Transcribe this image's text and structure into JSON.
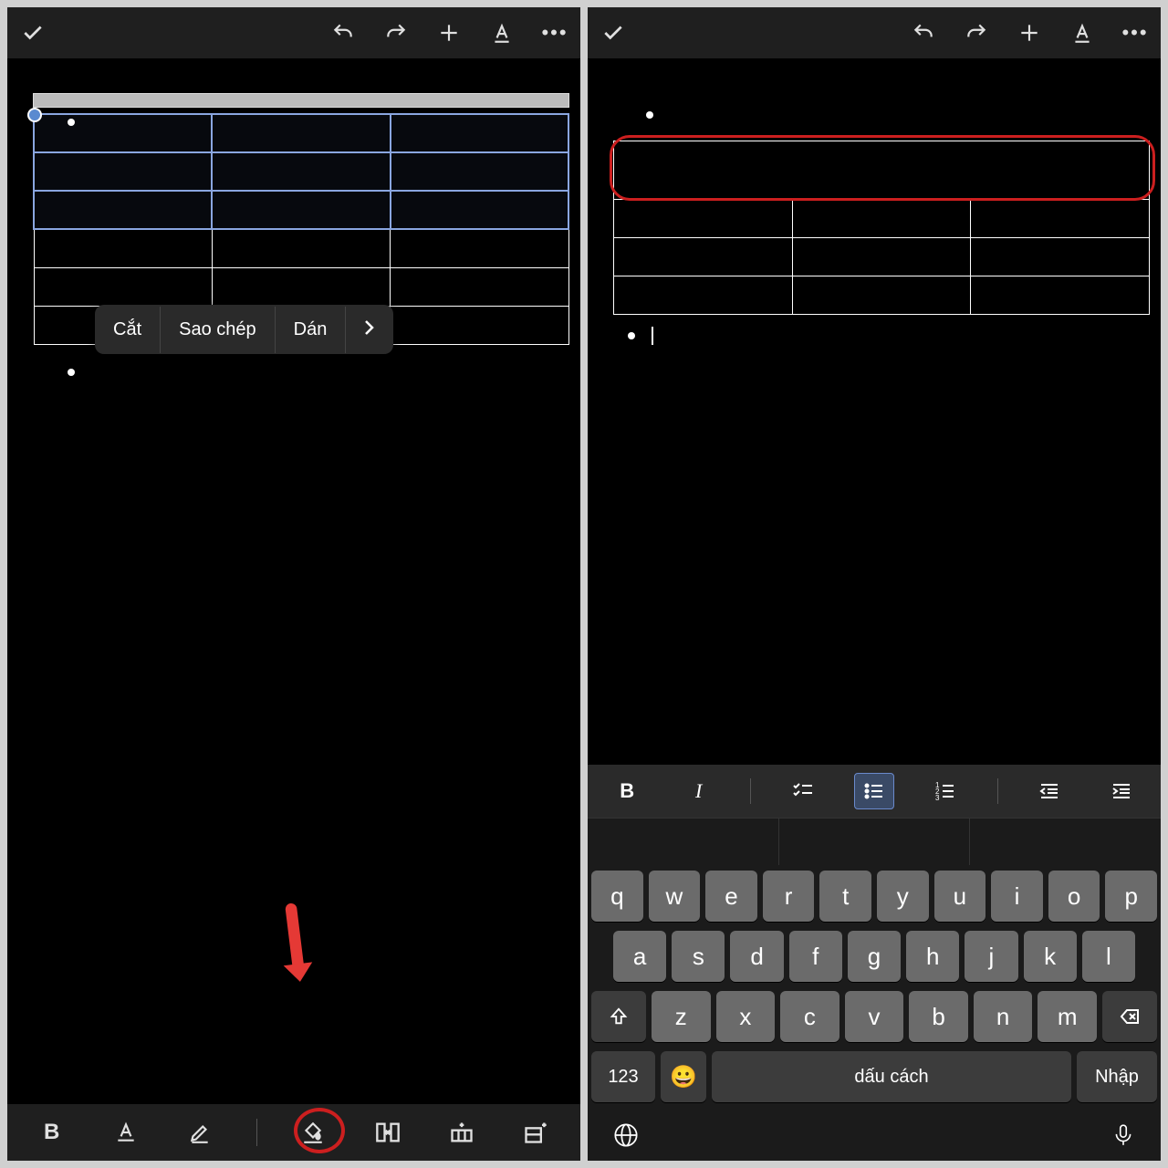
{
  "left": {
    "context_menu": {
      "cut": "Cắt",
      "copy": "Sao chép",
      "paste": "Dán"
    }
  },
  "right": {
    "keyboard": {
      "row1": [
        "q",
        "w",
        "e",
        "r",
        "t",
        "y",
        "u",
        "i",
        "o",
        "p"
      ],
      "row2": [
        "a",
        "s",
        "d",
        "f",
        "g",
        "h",
        "j",
        "k",
        "l"
      ],
      "row3": [
        "z",
        "x",
        "c",
        "v",
        "b",
        "n",
        "m"
      ],
      "numkey": "123",
      "space": "dấu cách",
      "enter": "Nhập"
    }
  }
}
